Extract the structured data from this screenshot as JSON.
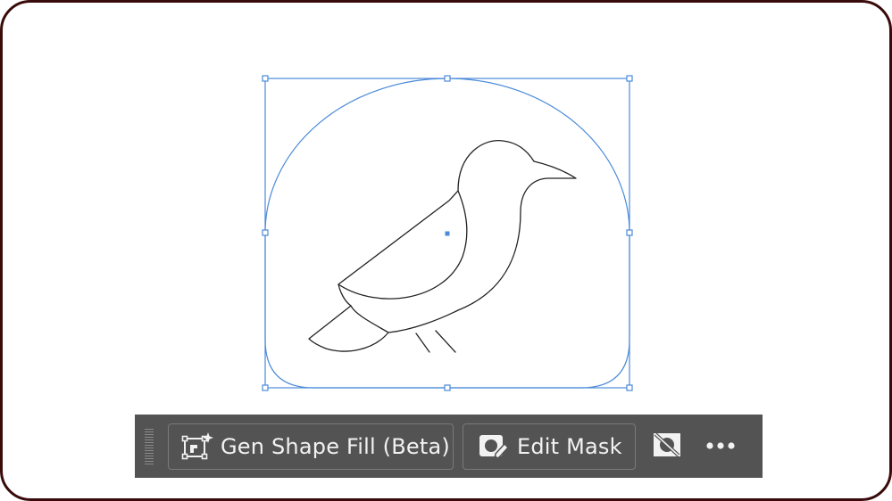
{
  "toolbar": {
    "gen_shape_fill_label": "Gen Shape Fill (Beta)",
    "edit_mask_label": "Edit Mask",
    "more_label": "•••"
  },
  "colors": {
    "selection": "#4a8ad8",
    "toolbar_bg": "#535353",
    "toolbar_text": "#f2f2f2",
    "frame_border": "#3a0b0b"
  },
  "icons": {
    "gen_shape_fill": "sparkle-frame-icon",
    "edit_mask": "mask-edit-icon",
    "hide_mask": "hide-mask-icon",
    "more": "more-options-icon"
  }
}
